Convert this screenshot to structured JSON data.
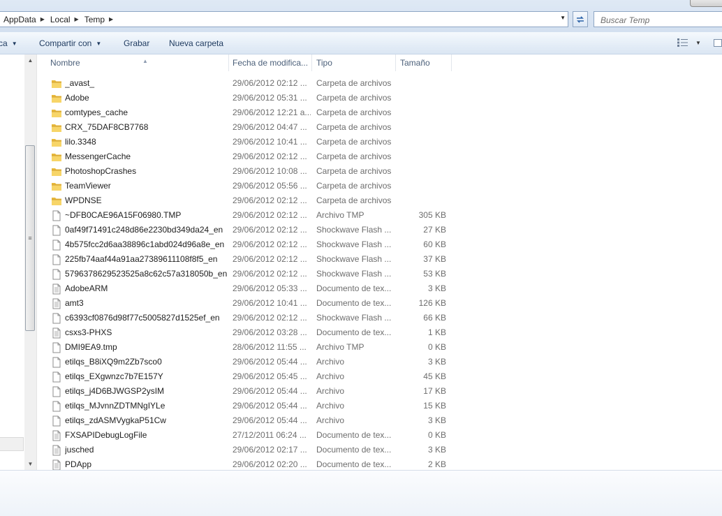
{
  "address": {
    "crumbs": [
      "AppData",
      "Local",
      "Temp"
    ],
    "search_placeholder": "Buscar Temp"
  },
  "toolbar": {
    "organize_label": "ca",
    "share_label": "Compartir con",
    "burn_label": "Grabar",
    "new_folder_label": "Nueva carpeta"
  },
  "columns": {
    "name": "Nombre",
    "date": "Fecha de modifica...",
    "type": "Tipo",
    "size": "Tamaño"
  },
  "files": [
    {
      "name": "_avast_",
      "date": "29/06/2012 02:12 ...",
      "type": "Carpeta de archivos",
      "size": "",
      "kind": "folder"
    },
    {
      "name": "Adobe",
      "date": "29/06/2012 05:31 ...",
      "type": "Carpeta de archivos",
      "size": "",
      "kind": "folder"
    },
    {
      "name": "comtypes_cache",
      "date": "29/06/2012 12:21 a...",
      "type": "Carpeta de archivos",
      "size": "",
      "kind": "folder"
    },
    {
      "name": "CRX_75DAF8CB7768",
      "date": "29/06/2012 04:47 ...",
      "type": "Carpeta de archivos",
      "size": "",
      "kind": "folder"
    },
    {
      "name": "lilo.3348",
      "date": "29/06/2012 10:41 ...",
      "type": "Carpeta de archivos",
      "size": "",
      "kind": "folder"
    },
    {
      "name": "MessengerCache",
      "date": "29/06/2012 02:12 ...",
      "type": "Carpeta de archivos",
      "size": "",
      "kind": "folder"
    },
    {
      "name": "PhotoshopCrashes",
      "date": "29/06/2012 10:08 ...",
      "type": "Carpeta de archivos",
      "size": "",
      "kind": "folder"
    },
    {
      "name": "TeamViewer",
      "date": "29/06/2012 05:56 ...",
      "type": "Carpeta de archivos",
      "size": "",
      "kind": "folder"
    },
    {
      "name": "WPDNSE",
      "date": "29/06/2012 02:12 ...",
      "type": "Carpeta de archivos",
      "size": "",
      "kind": "folder"
    },
    {
      "name": "~DFB0CAE96A15F06980.TMP",
      "date": "29/06/2012 02:12 ...",
      "type": "Archivo TMP",
      "size": "305 KB",
      "kind": "blank"
    },
    {
      "name": "0af49f71491c248d86e2230bd349da24_en",
      "date": "29/06/2012 02:12 ...",
      "type": "Shockwave Flash ...",
      "size": "27 KB",
      "kind": "blank"
    },
    {
      "name": "4b575fcc2d6aa38896c1abd024d96a8e_en",
      "date": "29/06/2012 02:12 ...",
      "type": "Shockwave Flash ...",
      "size": "60 KB",
      "kind": "blank"
    },
    {
      "name": "225fb74aaf44a91aa27389611108f8f5_en",
      "date": "29/06/2012 02:12 ...",
      "type": "Shockwave Flash ...",
      "size": "37 KB",
      "kind": "blank"
    },
    {
      "name": "5796378629523525a8c62c57a318050b_en",
      "date": "29/06/2012 02:12 ...",
      "type": "Shockwave Flash ...",
      "size": "53 KB",
      "kind": "blank"
    },
    {
      "name": "AdobeARM",
      "date": "29/06/2012 05:33 ...",
      "type": "Documento de tex...",
      "size": "3 KB",
      "kind": "text"
    },
    {
      "name": "amt3",
      "date": "29/06/2012 10:41 ...",
      "type": "Documento de tex...",
      "size": "126 KB",
      "kind": "text"
    },
    {
      "name": "c6393cf0876d98f77c5005827d1525ef_en",
      "date": "29/06/2012 02:12 ...",
      "type": "Shockwave Flash ...",
      "size": "66 KB",
      "kind": "blank"
    },
    {
      "name": "csxs3-PHXS",
      "date": "29/06/2012 03:28 ...",
      "type": "Documento de tex...",
      "size": "1 KB",
      "kind": "text"
    },
    {
      "name": "DMI9EA9.tmp",
      "date": "28/06/2012 11:55 ...",
      "type": "Archivo TMP",
      "size": "0 KB",
      "kind": "blank"
    },
    {
      "name": "etilqs_B8iXQ9m2Zb7sco0",
      "date": "29/06/2012 05:44 ...",
      "type": "Archivo",
      "size": "3 KB",
      "kind": "blank"
    },
    {
      "name": "etilqs_EXgwnzc7b7E157Y",
      "date": "29/06/2012 05:45 ...",
      "type": "Archivo",
      "size": "45 KB",
      "kind": "blank"
    },
    {
      "name": "etilqs_j4D6BJWGSP2ysIM",
      "date": "29/06/2012 05:44 ...",
      "type": "Archivo",
      "size": "17 KB",
      "kind": "blank"
    },
    {
      "name": "etilqs_MJvnnZDTMNgIYLe",
      "date": "29/06/2012 05:44 ...",
      "type": "Archivo",
      "size": "15 KB",
      "kind": "blank"
    },
    {
      "name": "etilqs_zdASMVygkaP51Cw",
      "date": "29/06/2012 05:44 ...",
      "type": "Archivo",
      "size": "3 KB",
      "kind": "blank"
    },
    {
      "name": "FXSAPIDebugLogFile",
      "date": "27/12/2011 06:24 ...",
      "type": "Documento de tex...",
      "size": "0 KB",
      "kind": "text"
    },
    {
      "name": "jusched",
      "date": "29/06/2012 02:17 ...",
      "type": "Documento de tex...",
      "size": "3 KB",
      "kind": "text"
    },
    {
      "name": "PDApp",
      "date": "29/06/2012 02:20 ...",
      "type": "Documento de tex...",
      "size": "2 KB",
      "kind": "text"
    }
  ]
}
